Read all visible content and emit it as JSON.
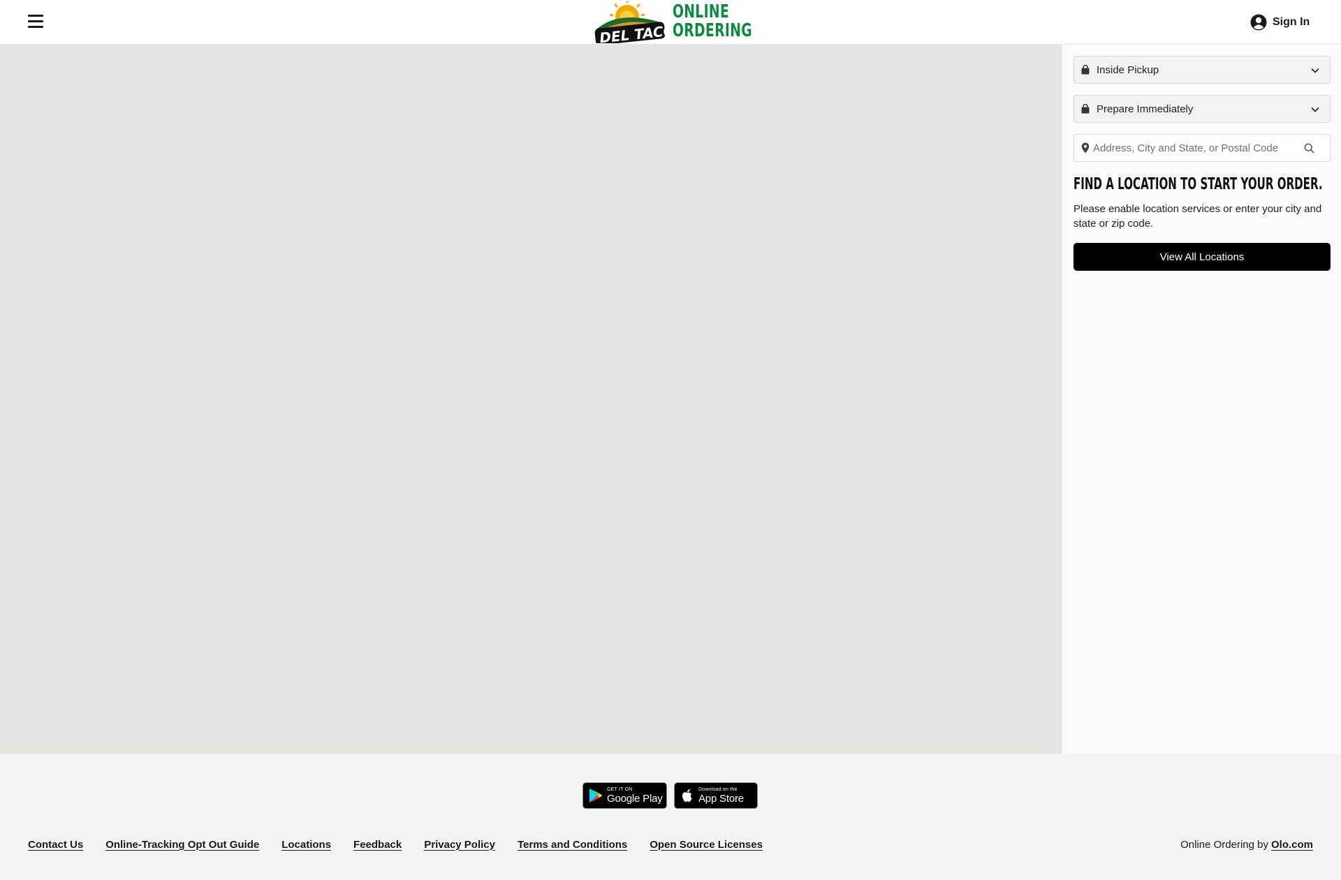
{
  "header": {
    "menu_icon": "hamburger-menu-icon",
    "logo_brand_text": "DEL TACO",
    "logo_line1": "ONLINE",
    "logo_line2": "ORDERING",
    "signin_icon": "user-circle-icon",
    "signin_label": "Sign In"
  },
  "sidebar": {
    "handoff": {
      "icon": "shopping-bag-icon",
      "selected": "Inside Pickup",
      "chevron_icon": "chevron-down-icon"
    },
    "timing": {
      "icon": "shopping-bag-icon",
      "selected": "Prepare Immediately",
      "chevron_icon": "chevron-down-icon"
    },
    "search": {
      "pin_icon": "map-pin-icon",
      "value": "",
      "placeholder": "Address, City and State, or Postal Code",
      "search_icon": "magnifier-icon"
    },
    "heading": "Find a location to start your order.",
    "description": "Please enable location services or enter your city and state or zip code.",
    "view_all_label": "View All Locations"
  },
  "footer": {
    "google_play": {
      "small": "GET IT ON",
      "big": "Google Play",
      "icon": "google-play-icon"
    },
    "app_store": {
      "small": "Download on the",
      "big": "App Store",
      "icon": "apple-icon"
    },
    "links": [
      "Contact Us",
      "Online-Tracking Opt Out Guide",
      "Locations",
      "Feedback",
      "Privacy Policy",
      "Terms and Conditions",
      "Open Source Licenses"
    ],
    "powered_prefix": "Online Ordering by",
    "powered_link": "Olo.com"
  },
  "colors": {
    "brand_green": "#0b8a3e",
    "map_background": "#e4e3e0",
    "button_black": "#000000",
    "footer_background": "#f4f4f4"
  }
}
